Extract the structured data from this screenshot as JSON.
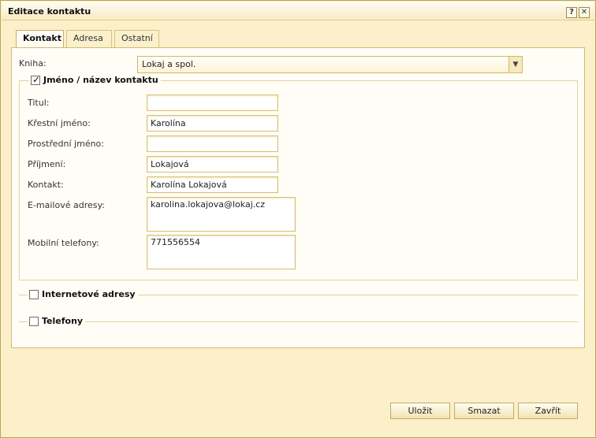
{
  "window": {
    "title": "Editace kontaktu",
    "help_glyph": "?",
    "close_glyph": "✕"
  },
  "tabs": [
    {
      "label": "Kontakt",
      "active": true
    },
    {
      "label": "Adresa",
      "active": false
    },
    {
      "label": "Ostatní",
      "active": false
    }
  ],
  "book": {
    "label": "Kniha:",
    "value": "Lokaj a spol."
  },
  "name_group": {
    "legend": "Jméno / název kontaktu",
    "checked": true,
    "fields": {
      "titul": {
        "label": "Titul:",
        "value": ""
      },
      "first": {
        "label": "Křestní jméno:",
        "value": "Karolína"
      },
      "middle": {
        "label": "Prostřední jméno:",
        "value": ""
      },
      "last": {
        "label": "Příjmení:",
        "value": "Lokajová"
      },
      "contact": {
        "label": "Kontakt:",
        "value": "Karolína Lokajová"
      },
      "emails": {
        "label": "E-mailové adresy:",
        "value": "karolina.lokajova@lokaj.cz"
      },
      "mobiles": {
        "label": "Mobilní telefony:",
        "value": "771556554"
      }
    }
  },
  "internet_group": {
    "legend": "Internetové adresy",
    "checked": false
  },
  "phones_group": {
    "legend": "Telefony",
    "checked": false
  },
  "buttons": {
    "save": "Uložit",
    "delete": "Smazat",
    "close": "Zavřít"
  }
}
